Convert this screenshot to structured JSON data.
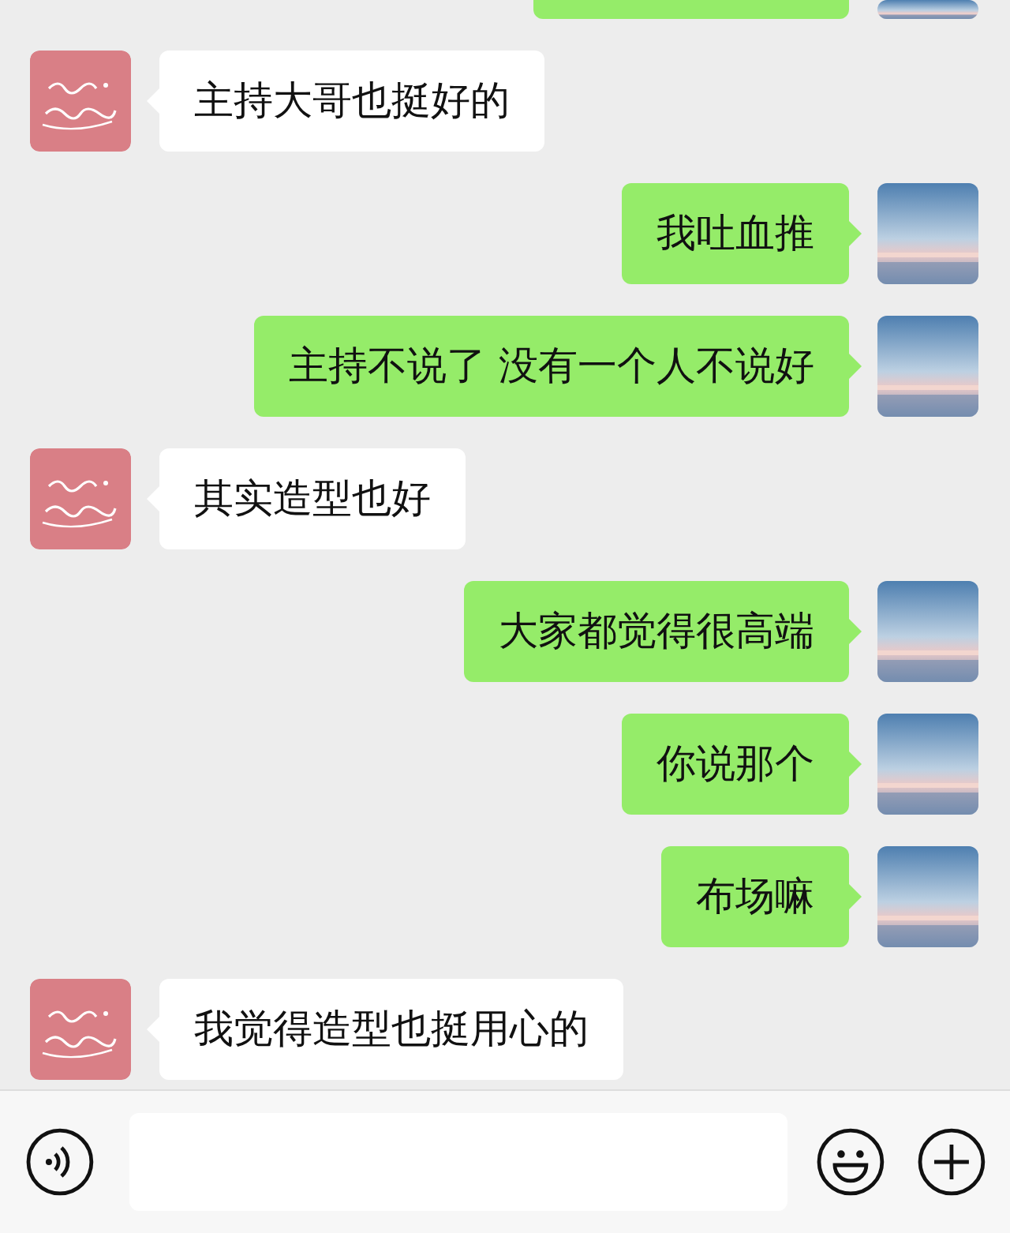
{
  "messages": [
    {
      "outgoing": true,
      "kind": "clipped"
    },
    {
      "outgoing": false,
      "kind": "text",
      "text": "主持大哥也挺好的"
    },
    {
      "outgoing": true,
      "kind": "text",
      "text": "我吐血推"
    },
    {
      "outgoing": true,
      "kind": "text",
      "text": "主持不说了 没有一个人不说好"
    },
    {
      "outgoing": false,
      "kind": "text",
      "text": "其实造型也好"
    },
    {
      "outgoing": true,
      "kind": "text",
      "text": "大家都觉得很高端"
    },
    {
      "outgoing": true,
      "kind": "text",
      "text": "你说那个"
    },
    {
      "outgoing": true,
      "kind": "text",
      "text": "布场嘛"
    },
    {
      "outgoing": false,
      "kind": "text",
      "text": "我觉得造型也挺用心的"
    }
  ]
}
